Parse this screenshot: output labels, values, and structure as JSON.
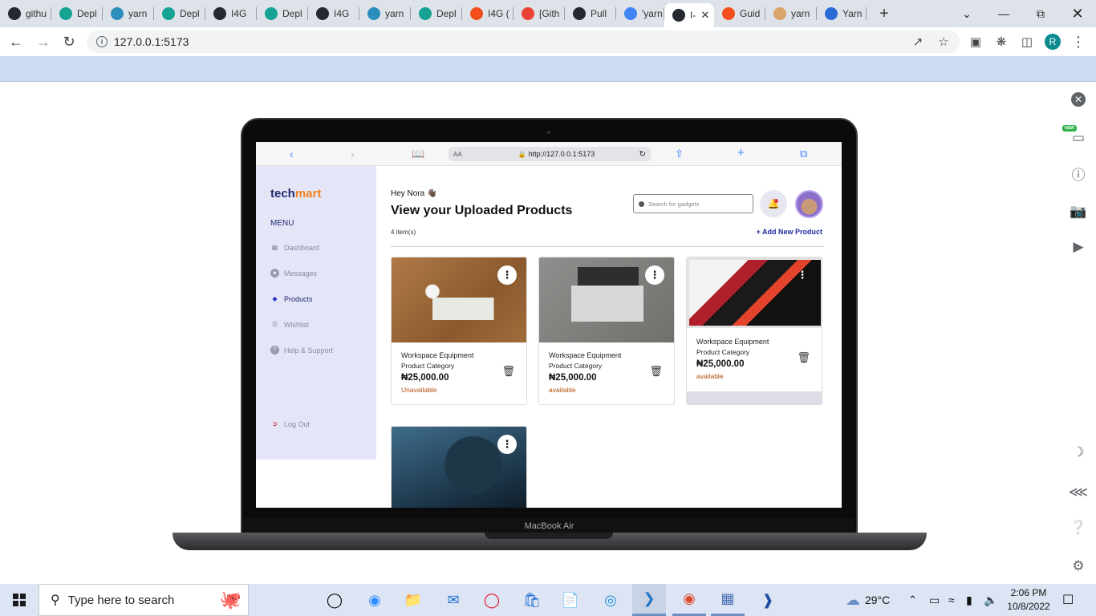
{
  "browser": {
    "tabs": [
      {
        "label": "githu",
        "fav_color": "#24292f",
        "icon": "github-icon"
      },
      {
        "label": "Depl",
        "fav_color": "#16a394",
        "icon": "netlify-icon"
      },
      {
        "label": "yarn",
        "fav_color": "#2c8ebb",
        "icon": "yarn-icon"
      },
      {
        "label": "Depl",
        "fav_color": "#16a394",
        "icon": "netlify-icon"
      },
      {
        "label": "I4G",
        "fav_color": "#24292f",
        "icon": "globe-icon"
      },
      {
        "label": "Depl",
        "fav_color": "#16a394",
        "icon": "netlify-icon"
      },
      {
        "label": "I4G",
        "fav_color": "#24292f",
        "icon": "globe-icon"
      },
      {
        "label": "yarn",
        "fav_color": "#2c8ebb",
        "icon": "yarn-icon"
      },
      {
        "label": "Depl",
        "fav_color": "#16a394",
        "icon": "netlify-icon"
      },
      {
        "label": "I4G (",
        "fav_color": "#f24e1e",
        "icon": "figma-icon"
      },
      {
        "label": "[Gith",
        "fav_color": "#ea4335",
        "icon": "gmail-icon"
      },
      {
        "label": "Pull",
        "fav_color": "#24292f",
        "icon": "github-icon"
      },
      {
        "label": "'yarn",
        "fav_color": "#4285f4",
        "icon": "google-icon"
      },
      {
        "label": "I-",
        "fav_color": "#24292f",
        "icon": "globe-icon",
        "active": true
      },
      {
        "label": "Guid",
        "fav_color": "#f24e1e",
        "icon": "figma-icon"
      },
      {
        "label": "yarn",
        "fav_color": "#d9a56a",
        "icon": "yarn-icon"
      },
      {
        "label": "Yarn",
        "fav_color": "#2c6bd6",
        "icon": "yarn-icon"
      }
    ],
    "url": "127.0.0.1:5173",
    "profile_initial": "R"
  },
  "device": {
    "label": "MacBook Air",
    "safari_url": "http://127.0.0.1:5173",
    "safari_aa": "AA"
  },
  "app": {
    "logo_part1": "tech",
    "logo_part2": "mart",
    "menu_heading": "MENU",
    "menu": [
      {
        "label": "Dashboard",
        "icon": "grid-icon"
      },
      {
        "label": "Messages",
        "icon": "chat-icon"
      },
      {
        "label": "Products",
        "icon": "cube-icon",
        "active": true
      },
      {
        "label": "Wishlist",
        "icon": "list-icon"
      },
      {
        "label": "Help & Support",
        "icon": "help-icon"
      }
    ],
    "logout": "Log Out",
    "greeting": "Hey Nora",
    "title": "View your Uploaded Products",
    "count": "4 item(s)",
    "search_placeholder": "Search for gadgets",
    "add_new": "+ Add New Product",
    "products": [
      {
        "title": "Workspace Equipment",
        "category": "Product Category",
        "price": "₦25,000.00",
        "status": "Unavailable"
      },
      {
        "title": "Workspace Equipment",
        "category": "Product Category",
        "price": "₦25,000.00",
        "status": "available"
      },
      {
        "title": "Workspace Equipment",
        "category": "Product Category",
        "price": "₦25,000.00",
        "status": "available"
      },
      {
        "title": "",
        "category": "",
        "price": "",
        "status": ""
      }
    ]
  },
  "taskbar": {
    "search_placeholder": "Type here to search",
    "weather": "29°C",
    "time": "2:06 PM",
    "date": "10/8/2022"
  },
  "side_panel": {
    "badge_new": "NEW"
  }
}
